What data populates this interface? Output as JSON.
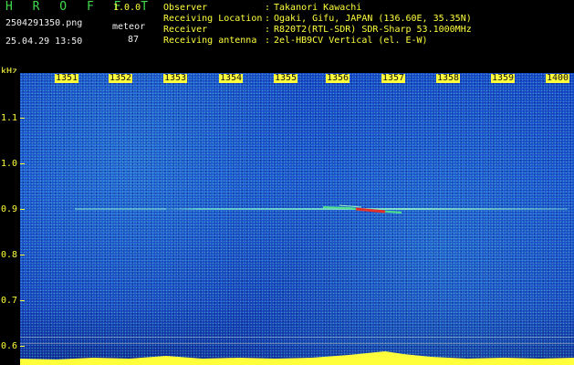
{
  "header": {
    "brand": "H R O F F T",
    "version": "1.0.0",
    "filename": "2504291350.png",
    "datetime": "25.04.29 13:50",
    "mode": "meteor",
    "count": "87",
    "meta": [
      {
        "label": "Observer",
        "value": "Takanori Kawachi"
      },
      {
        "label": "Receiving Location",
        "value": "Ogaki, Gifu, JAPAN (136.60E, 35.35N)"
      },
      {
        "label": "Receiver",
        "value": "R820T2(RTL-SDR) SDR-Sharp 53.1000MHz"
      },
      {
        "label": "Receiving antenna",
        "value": "2el-HB9CV Vertical (el. E-W)"
      }
    ],
    "separator": ":"
  },
  "axes": {
    "y_unit": "kHz",
    "y_ticks": [
      "1.1",
      "1.0",
      "0.9",
      "0.8",
      "0.7",
      "0.6"
    ],
    "x_ticks": [
      "1351",
      "1352",
      "1353",
      "1354",
      "1355",
      "1356",
      "1357",
      "1358",
      "1359",
      "1400"
    ]
  },
  "colors": {
    "background": "#000000",
    "waterfall_blue": "#1a4fd2",
    "label_yellow": "#ffff3c",
    "label_green": "#3fd94a",
    "label_white": "#f0f0f0"
  }
}
